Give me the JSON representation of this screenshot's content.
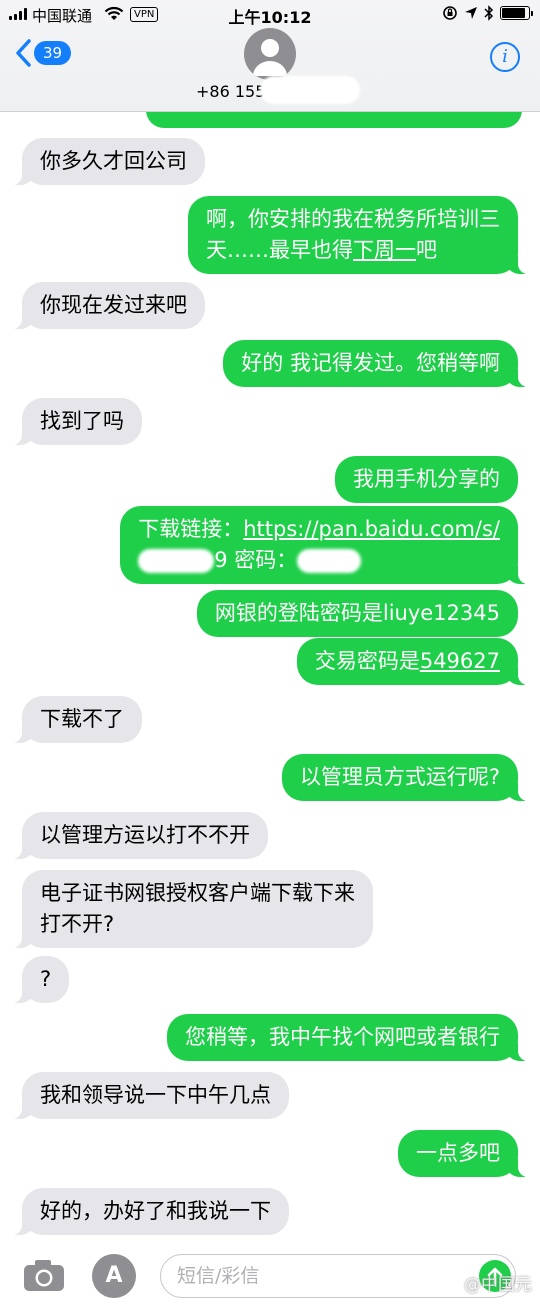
{
  "status_bar": {
    "carrier": "中国联通",
    "vpn": "VPN",
    "time": "上午10:12",
    "battery_level": 0.9
  },
  "header": {
    "back_count": "39",
    "contact": "+86 155"
  },
  "messages": [
    {
      "side": "in",
      "text": "你多久才回公司"
    },
    {
      "side": "out",
      "line1": "啊，你安排的我在税务所培训三",
      "line2_pre": "天……最早也得",
      "line2_link": "下周一",
      "line2_post": "吧"
    },
    {
      "side": "in",
      "text": "你现在发过来吧"
    },
    {
      "side": "out",
      "text": "好的 我记得发过。您稍等啊"
    },
    {
      "side": "in",
      "text": "找到了吗"
    },
    {
      "side": "out",
      "text": "我用手机分享的"
    },
    {
      "side": "out",
      "line1_pre": "下载链接：",
      "line1_link": "https://pan.baidu.com/s/",
      "line2_a": "9",
      "line2_b": " 密码："
    },
    {
      "side": "out",
      "text": "网银的登陆密码是liuye12345"
    },
    {
      "side": "out",
      "pre": "交易密码是",
      "link": "549627"
    },
    {
      "side": "in",
      "text": "下载不了"
    },
    {
      "side": "out",
      "text": "以管理员方式运行呢?"
    },
    {
      "side": "in",
      "text": "以管理方运以打不不开"
    },
    {
      "side": "in",
      "line1": "电子证书网银授权客户端下载下来",
      "line2": "打不开?"
    },
    {
      "side": "in",
      "text": "?"
    },
    {
      "side": "out",
      "text": "您稍等，我中午找个网吧或者银行"
    },
    {
      "side": "in",
      "text": "我和领导说一下中午几点"
    },
    {
      "side": "out",
      "text": "一点多吧"
    },
    {
      "side": "in",
      "text": "好的，办好了和我说一下"
    }
  ],
  "input": {
    "placeholder": "短信/彩信"
  },
  "watermark": "@中国元"
}
